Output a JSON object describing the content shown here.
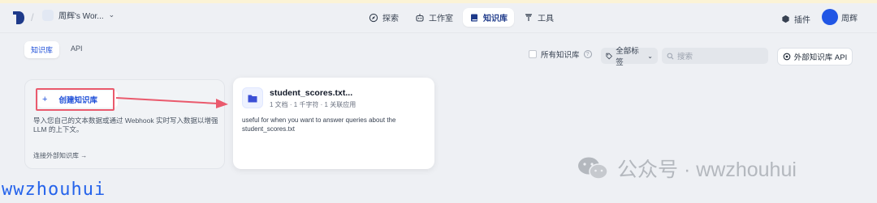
{
  "header": {
    "workspace": "周辉's Wor...",
    "nav": [
      {
        "label": "探索",
        "icon": "compass-icon",
        "active": false
      },
      {
        "label": "工作室",
        "icon": "robot-icon",
        "active": false
      },
      {
        "label": "知识库",
        "icon": "book-icon",
        "active": true
      },
      {
        "label": "工具",
        "icon": "tools-icon",
        "active": false
      }
    ],
    "plugin_label": "插件",
    "user_name": "周辉"
  },
  "tabs": [
    "知识库",
    "API"
  ],
  "toolbar": {
    "all_knowledge_label": "所有知识库",
    "tag_label": "全部标签",
    "search_placeholder": "搜索",
    "external_api_label": "外部知识库 API"
  },
  "create_card": {
    "button_label": "创建知识库",
    "description": "导入您自己的文本数据或通过 Webhook 实时写入数据以增强 LLM 的上下文。",
    "connect_label": "连接外部知识库 →"
  },
  "dataset": {
    "name": "student_scores.txt...",
    "meta": "1 文档 · 1 千字符 · 1 关联应用",
    "description": "useful for when you want to answer queries about the student_scores.txt"
  },
  "watermarks": {
    "wechat": "公众号 · wwzhouhui",
    "bottom": "wwzhouhui"
  },
  "colors": {
    "accent": "#1d4ed8",
    "annotation": "#ea5a6d"
  }
}
